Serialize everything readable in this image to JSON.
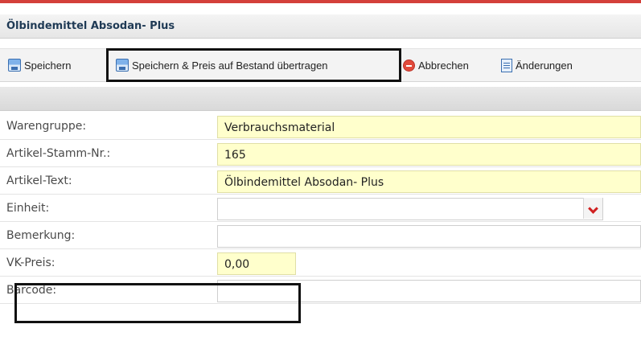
{
  "window": {
    "title": "Ölbindemittel Absodan- Plus"
  },
  "toolbar": {
    "save_label": "Speichern",
    "save_transfer_label": "Speichern & Preis auf Bestand übertragen",
    "cancel_label": "Abbrechen",
    "changes_label": "Änderungen"
  },
  "form": {
    "warengruppe": {
      "label": "Warengruppe:",
      "value": "Verbrauchsmaterial"
    },
    "artikel_stamm_nr": {
      "label": "Artikel-Stamm-Nr.:",
      "value": "165"
    },
    "artikel_text": {
      "label": "Artikel-Text:",
      "value": "Ölbindemittel Absodan- Plus"
    },
    "einheit": {
      "label": "Einheit:",
      "value": ""
    },
    "bemerkung": {
      "label": "Bemerkung:",
      "value": ""
    },
    "vk_preis": {
      "label": "VK-Preis:",
      "value": "0,00"
    },
    "barcode": {
      "label": "Barcode:",
      "value": ""
    }
  },
  "colors": {
    "accent_red": "#d4403a",
    "field_yellow": "#ffffcc",
    "title_text": "#1f3a55"
  }
}
